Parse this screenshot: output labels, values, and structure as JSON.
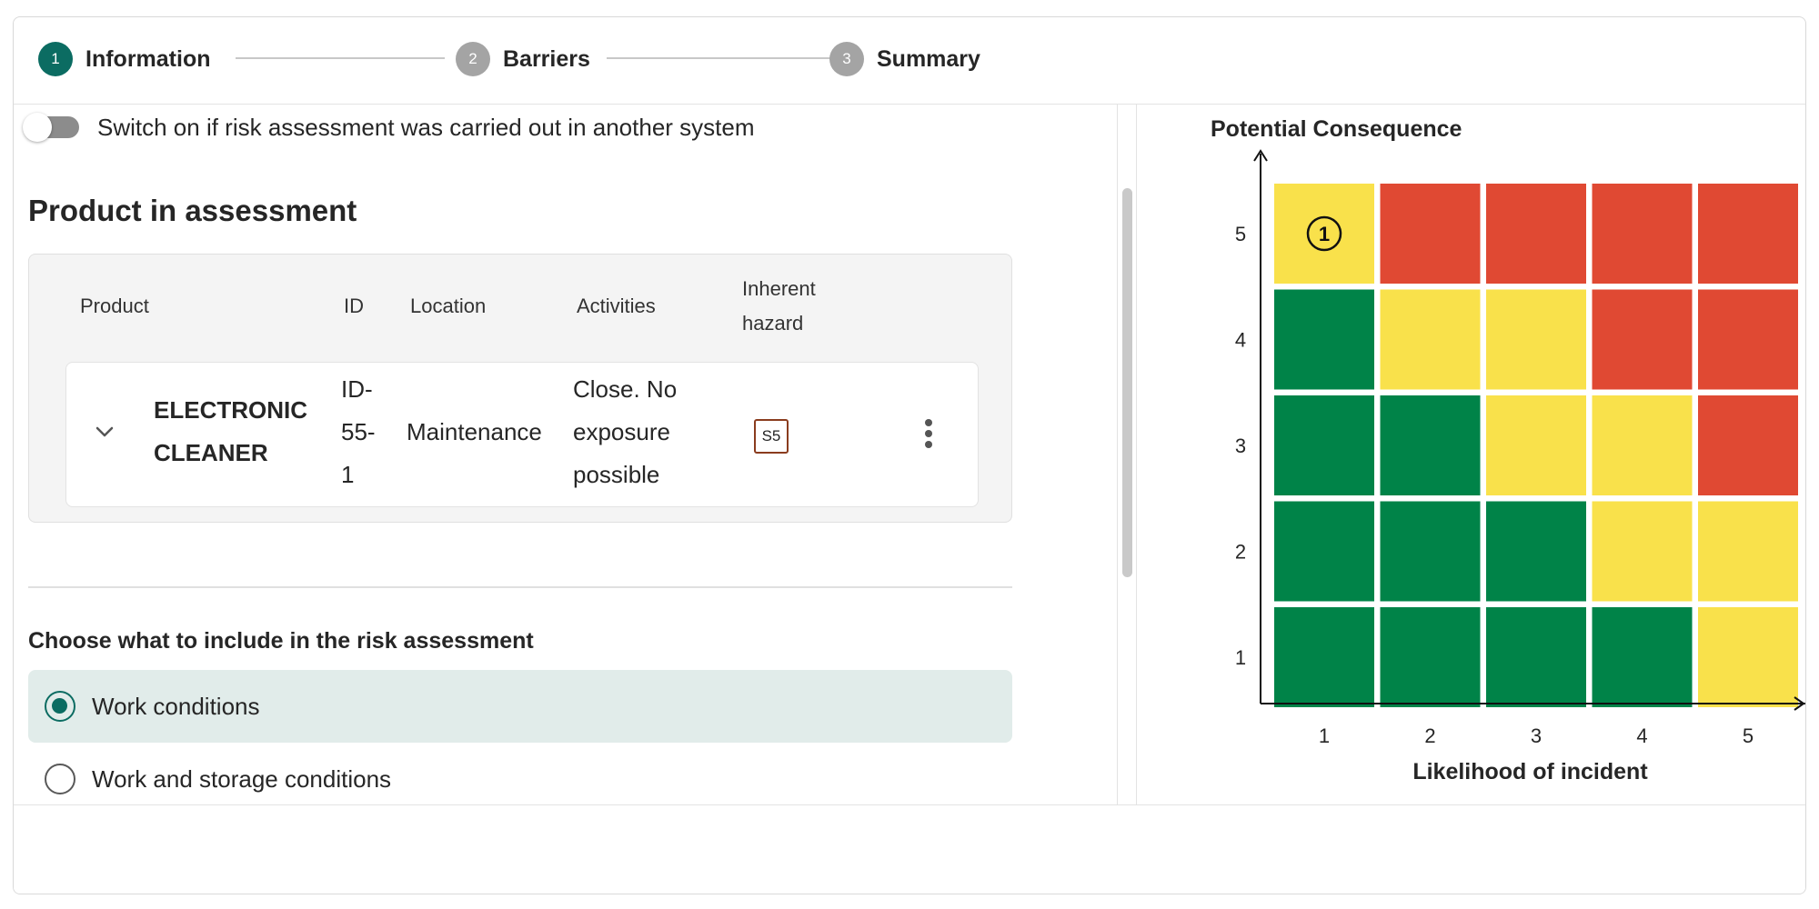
{
  "stepper": {
    "steps": [
      {
        "number": "1",
        "label": "Information",
        "state": "active"
      },
      {
        "number": "2",
        "label": "Barriers",
        "state": "inactive"
      },
      {
        "number": "3",
        "label": "Summary",
        "state": "inactive"
      }
    ]
  },
  "toggle": {
    "label": "Switch on if risk assessment was carried out in another system",
    "checked": false
  },
  "product_section": {
    "title": "Product in assessment",
    "columns": {
      "product": "Product",
      "id": "ID",
      "location": "Location",
      "activities": "Activities",
      "inherent_hazard_line1": "Inherent",
      "inherent_hazard_line2": "hazard"
    },
    "row": {
      "product_line1": "ELECTRONIC",
      "product_line2": "CLEANER",
      "id_line1": "ID-",
      "id_line2": "55-",
      "id_line3": "1",
      "location": "Maintenance",
      "activities_line1": "Close. No",
      "activities_line2": "exposure",
      "activities_line3": "possible",
      "hazard_badge": "S5"
    }
  },
  "include_section": {
    "title": "Choose what to include in the risk assessment",
    "options": [
      {
        "label": "Work conditions",
        "selected": true
      },
      {
        "label": "Work and storage conditions",
        "selected": false
      }
    ]
  },
  "risk_matrix": {
    "y_title": "Potential Consequence",
    "x_title": "Likelihood of incident",
    "x_ticks": [
      "1",
      "2",
      "3",
      "4",
      "5"
    ],
    "y_ticks": [
      "5",
      "4",
      "3",
      "2",
      "1"
    ],
    "colors": {
      "green": "#008348",
      "yellow": "#f9e14b",
      "red": "#e04933"
    },
    "grid": [
      [
        "yellow",
        "red",
        "red",
        "red",
        "red"
      ],
      [
        "green",
        "yellow",
        "yellow",
        "red",
        "red"
      ],
      [
        "green",
        "green",
        "yellow",
        "yellow",
        "red"
      ],
      [
        "green",
        "green",
        "green",
        "yellow",
        "yellow"
      ],
      [
        "green",
        "green",
        "green",
        "green",
        "yellow"
      ]
    ],
    "marker": {
      "label": "1",
      "likelihood": 1,
      "consequence": 5
    }
  }
}
